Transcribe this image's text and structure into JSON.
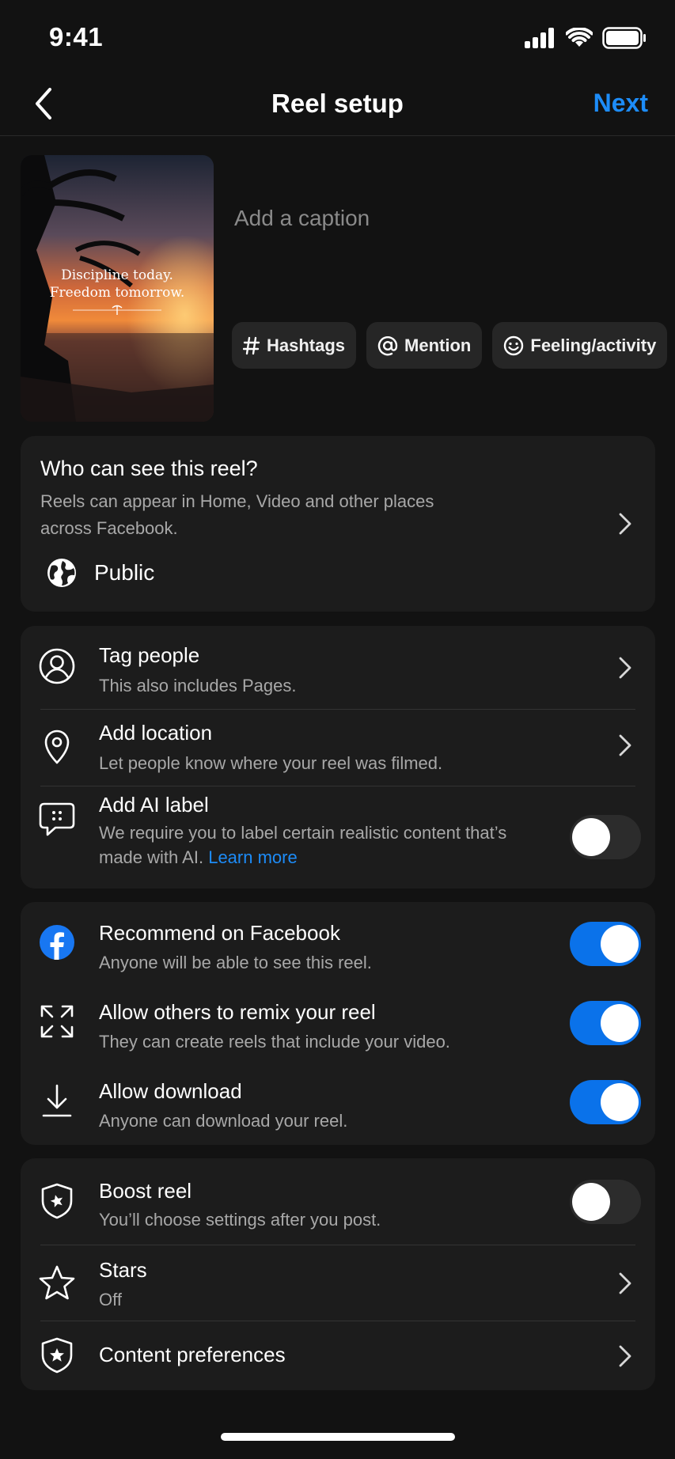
{
  "status": {
    "time": "9:41"
  },
  "nav": {
    "title": "Reel setup",
    "next": "Next"
  },
  "thumbnail": {
    "line1": "Discipline today.",
    "line2": "Freedom tomorrow."
  },
  "caption_placeholder": "Add a caption",
  "chips": [
    {
      "label": "Hashtags",
      "icon": "hashtag-icon"
    },
    {
      "label": "Mention",
      "icon": "at-icon"
    },
    {
      "label": "Feeling/activity",
      "icon": "smile-icon"
    }
  ],
  "audience": {
    "title": "Who can see this reel?",
    "desc": "Reels can appear in Home, Video and other places across Facebook.",
    "value": "Public"
  },
  "details": {
    "tag_people": {
      "title": "Tag people",
      "sub": "This also includes Pages."
    },
    "location": {
      "title": "Add location",
      "sub": "Let people know where your reel was filmed."
    },
    "ai_label": {
      "title": "Add AI label",
      "sub": "We require you to label certain realistic content that’s made with AI.",
      "link": "Learn more",
      "enabled": false
    }
  },
  "sharing": {
    "recommend": {
      "title": "Recommend on Facebook",
      "sub": "Anyone will be able to see this reel.",
      "enabled": true
    },
    "remix": {
      "title": "Allow others to remix your reel",
      "sub": "They can create reels that include your video.",
      "enabled": true
    },
    "download": {
      "title": "Allow download",
      "sub": "Anyone can download your reel.",
      "enabled": true
    }
  },
  "extras": {
    "boost": {
      "title": "Boost reel",
      "sub": "You’ll choose settings after you post.",
      "enabled": false
    },
    "stars": {
      "title": "Stars",
      "sub": "Off"
    },
    "content_prefs": {
      "title": "Content preferences"
    }
  },
  "colors": {
    "accent": "#1d8cf8",
    "toggle_on": "#0a72ea",
    "card": "#1c1c1c",
    "background": "#121212"
  }
}
